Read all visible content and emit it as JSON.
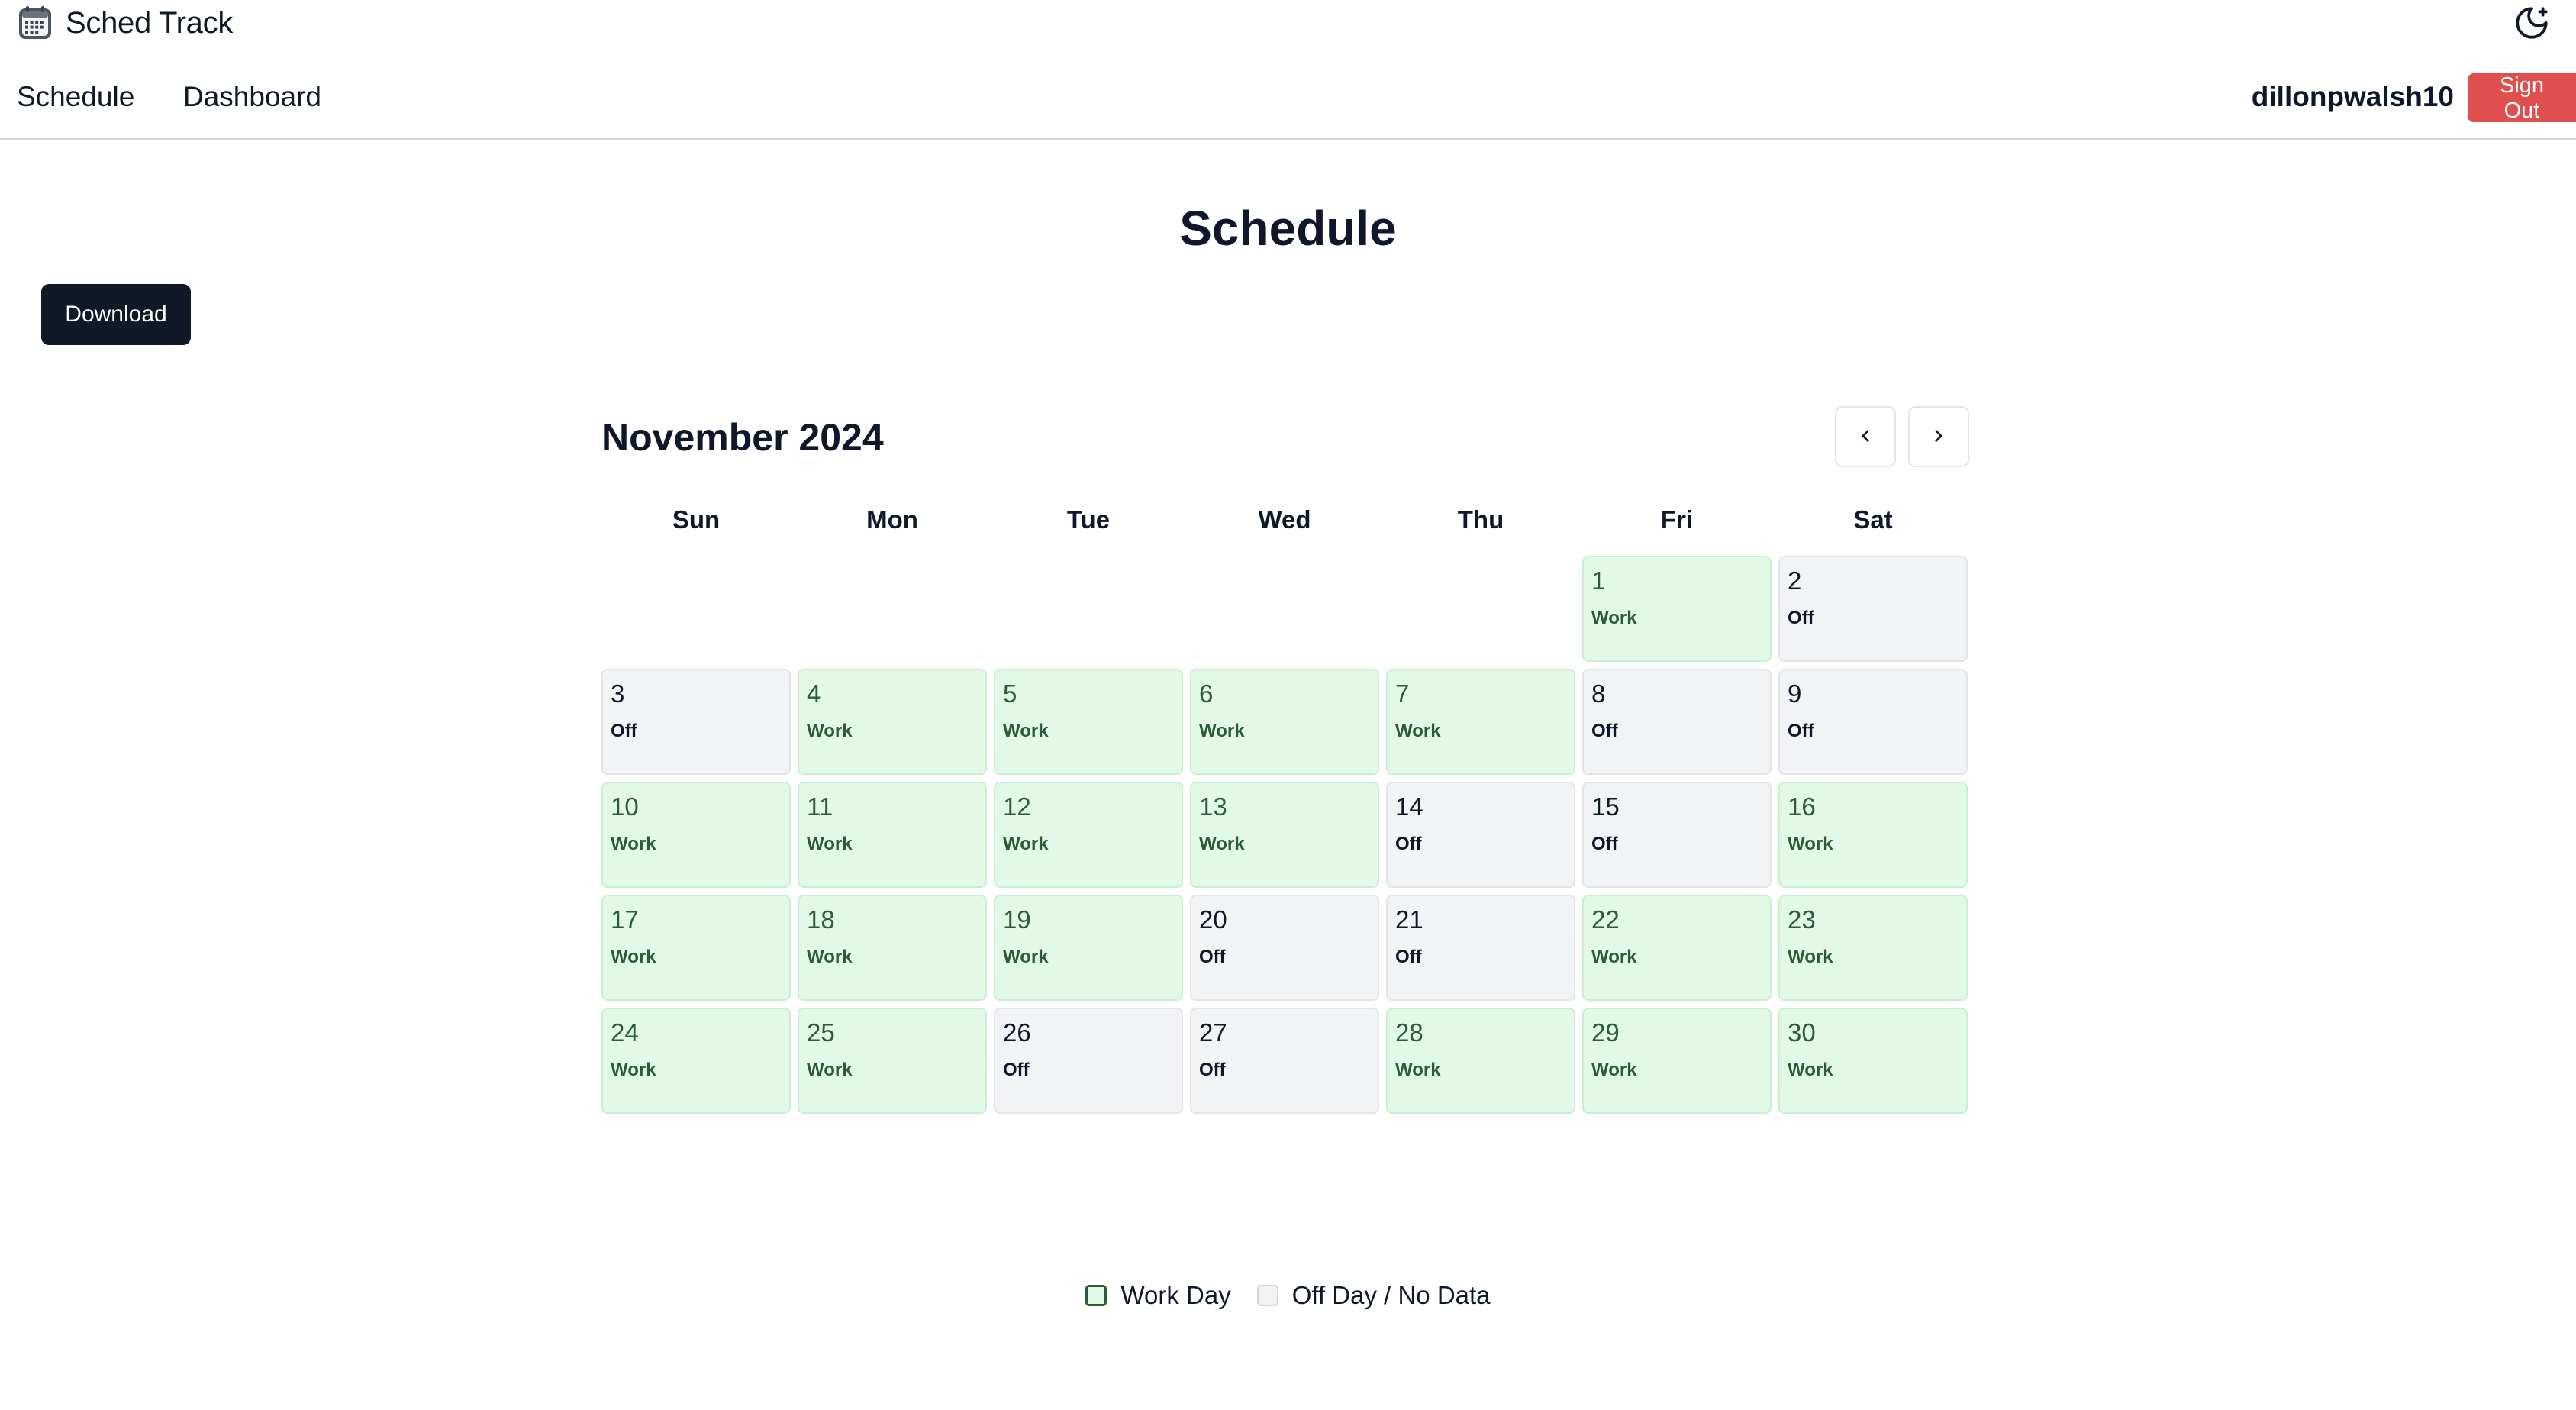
{
  "app": {
    "title": "Sched Track",
    "logo_icon": "calendar-icon",
    "theme_icon": "moon-icon"
  },
  "nav": {
    "items": [
      {
        "label": "Schedule"
      },
      {
        "label": "Dashboard"
      }
    ],
    "username": "dillonpwalsh10",
    "sign_out_label": "Sign Out"
  },
  "page": {
    "title": "Schedule",
    "download_label": "Download"
  },
  "calendar": {
    "month_title": "November 2024",
    "prev_icon": "chevron-left-icon",
    "next_icon": "chevron-right-icon",
    "weekdays": [
      "Sun",
      "Mon",
      "Tue",
      "Wed",
      "Thu",
      "Fri",
      "Sat"
    ],
    "leading_blanks": 5,
    "days": [
      {
        "day": "1",
        "status": "Work"
      },
      {
        "day": "2",
        "status": "Off"
      },
      {
        "day": "3",
        "status": "Off"
      },
      {
        "day": "4",
        "status": "Work"
      },
      {
        "day": "5",
        "status": "Work"
      },
      {
        "day": "6",
        "status": "Work"
      },
      {
        "day": "7",
        "status": "Work"
      },
      {
        "day": "8",
        "status": "Off"
      },
      {
        "day": "9",
        "status": "Off"
      },
      {
        "day": "10",
        "status": "Work"
      },
      {
        "day": "11",
        "status": "Work"
      },
      {
        "day": "12",
        "status": "Work"
      },
      {
        "day": "13",
        "status": "Work"
      },
      {
        "day": "14",
        "status": "Off"
      },
      {
        "day": "15",
        "status": "Off"
      },
      {
        "day": "16",
        "status": "Work"
      },
      {
        "day": "17",
        "status": "Work"
      },
      {
        "day": "18",
        "status": "Work"
      },
      {
        "day": "19",
        "status": "Work"
      },
      {
        "day": "20",
        "status": "Off"
      },
      {
        "day": "21",
        "status": "Off"
      },
      {
        "day": "22",
        "status": "Work"
      },
      {
        "day": "23",
        "status": "Work"
      },
      {
        "day": "24",
        "status": "Work"
      },
      {
        "day": "25",
        "status": "Work"
      },
      {
        "day": "26",
        "status": "Off"
      },
      {
        "day": "27",
        "status": "Off"
      },
      {
        "day": "28",
        "status": "Work"
      },
      {
        "day": "29",
        "status": "Work"
      },
      {
        "day": "30",
        "status": "Work"
      }
    ]
  },
  "legend": {
    "work_label": "Work Day",
    "off_label": "Off Day / No Data"
  },
  "colors": {
    "work_bg": "#e1f9e6",
    "work_text": "#2d5a37",
    "off_bg": "#f2f3f5",
    "primary_button": "#111827",
    "sign_out": "#e04e4e"
  }
}
